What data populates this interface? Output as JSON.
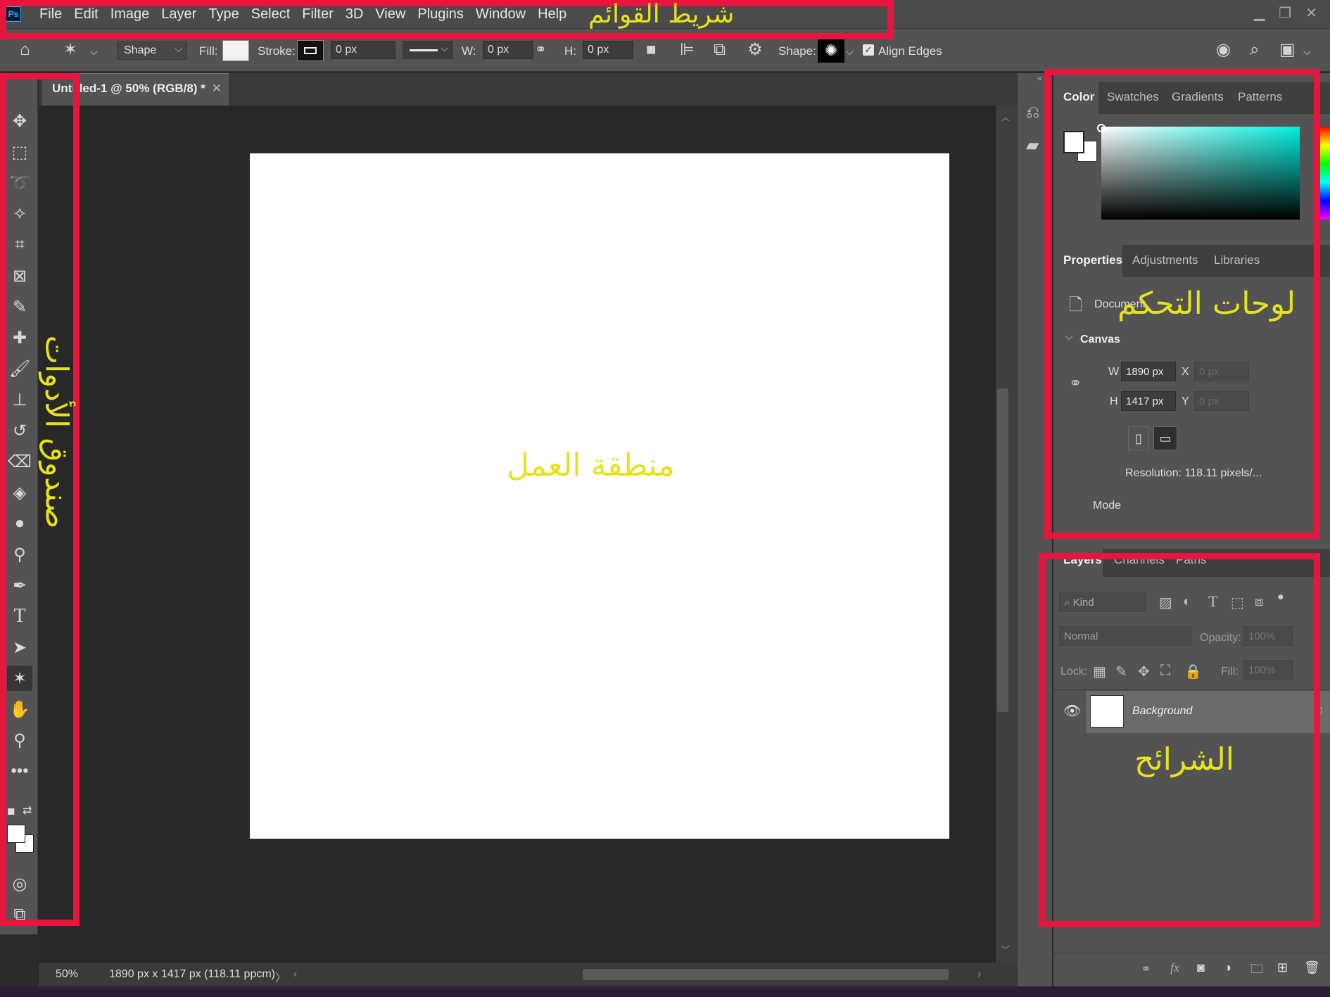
{
  "menubar": {
    "logo": "Ps",
    "items": [
      "File",
      "Edit",
      "Image",
      "Layer",
      "Type",
      "Select",
      "Filter",
      "3D",
      "View",
      "Plugins",
      "Window",
      "Help"
    ]
  },
  "options": {
    "mode": "Shape",
    "fill_label": "Fill:",
    "stroke_label": "Stroke:",
    "stroke_width": "0 px",
    "w_label": "W:",
    "w_value": "0 px",
    "h_label": "H:",
    "h_value": "0 px",
    "shape_label": "Shape:",
    "align_edges": "Align Edges"
  },
  "document": {
    "tab_title": "Untitled-1 @ 50% (RGB/8) *",
    "zoom": "50%",
    "doc_info": "1890 px x 1417 px (118.11 ppcm)"
  },
  "color_panel": {
    "tabs": [
      "Color",
      "Swatches",
      "Gradients",
      "Patterns"
    ],
    "active_tab": "Color"
  },
  "properties_panel": {
    "tabs": [
      "Properties",
      "Adjustments",
      "Libraries"
    ],
    "active_tab": "Properties",
    "doc_label": "Document",
    "section": "Canvas",
    "w_label": "W",
    "w_value": "1890 px",
    "h_label": "H",
    "h_value": "1417 px",
    "x_label": "X",
    "x_placeholder": "0 px",
    "y_label": "Y",
    "y_placeholder": "0 px",
    "resolution": "Resolution: 118.11 pixels/...",
    "mode_label": "Mode"
  },
  "layers_panel": {
    "tabs": [
      "Layers",
      "Channels",
      "Paths"
    ],
    "active_tab": "Layers",
    "filter_kind": "Kind",
    "blend_mode": "Normal",
    "opacity_label": "Opacity:",
    "opacity_value": "100%",
    "lock_label": "Lock:",
    "fill_label": "Fill:",
    "fill_value": "100%",
    "layers": [
      {
        "name": "Background"
      }
    ]
  },
  "annotations": {
    "menu_bar": "شريط القوائم",
    "toolbox": "صندوق الأدوات",
    "work_area": "منطقة العمل",
    "panels": "لوحات التحكم",
    "layers": "الشرائح"
  },
  "colors": {
    "annotation_box": "#e8163f",
    "annotation_text": "#e6e21b",
    "ui_panel": "#535353",
    "pasteboard": "#282828"
  }
}
